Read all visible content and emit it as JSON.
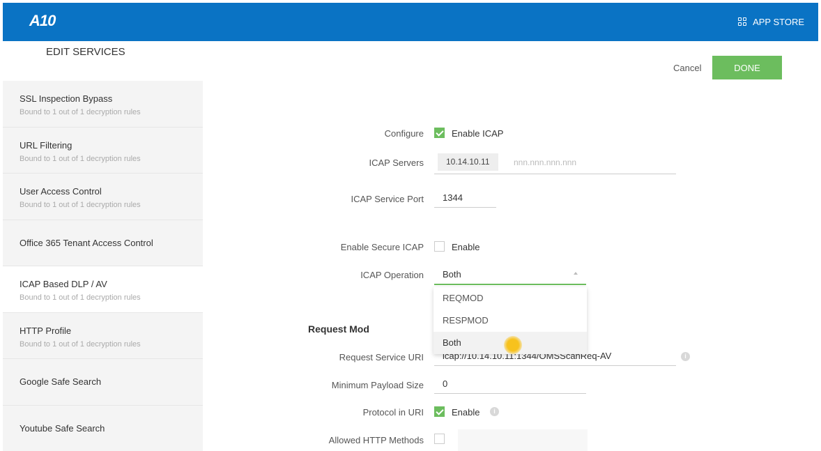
{
  "header": {
    "logo_text": "A10",
    "app_store_label": "APP STORE",
    "bar_color": "#0a73c4"
  },
  "page": {
    "title": "EDIT SERVICES",
    "cancel_label": "Cancel",
    "done_label": "DONE",
    "accent_color": "#6cbd5e"
  },
  "sidebar": {
    "items": [
      {
        "title": "SSL Inspection Bypass",
        "subtitle": "Bound to 1 out of 1 decryption rules"
      },
      {
        "title": "URL Filtering",
        "subtitle": "Bound to 1 out of 1 decryption rules"
      },
      {
        "title": "User Access Control",
        "subtitle": "Bound to 1 out of 1 decryption rules"
      },
      {
        "title": "Office 365 Tenant Access Control",
        "subtitle": ""
      },
      {
        "title": "ICAP Based DLP / AV",
        "subtitle": "Bound to 1 out of 1 decryption rules",
        "active": true
      },
      {
        "title": "HTTP Profile",
        "subtitle": "Bound to 1 out of 1 decryption rules"
      },
      {
        "title": "Google Safe Search",
        "subtitle": ""
      },
      {
        "title": "Youtube Safe Search",
        "subtitle": ""
      }
    ]
  },
  "form": {
    "configure_label": "Configure",
    "enable_icap_label": "Enable ICAP",
    "enable_icap_checked": true,
    "icap_servers_label": "ICAP Servers",
    "icap_server_value": "10.14.10.11",
    "icap_server_placeholder": "nnn.nnn.nnn.nnn",
    "icap_port_label": "ICAP Service Port",
    "icap_port_value": "1344",
    "secure_icap_label": "Enable Secure ICAP",
    "secure_icap_option": "Enable",
    "secure_icap_checked": false,
    "icap_operation_label": "ICAP Operation",
    "icap_operation_value": "Both",
    "icap_operation_options": [
      "REQMOD",
      "RESPMOD",
      "Both"
    ],
    "request_mod_heading": "Request Mod",
    "request_uri_label": "Request Service URI",
    "request_uri_value": "icap://10.14.10.11:1344/OMSScanReq-AV",
    "min_payload_label": "Minimum Payload Size",
    "min_payload_value": "0",
    "protocol_uri_label": "Protocol in URI",
    "protocol_uri_option": "Enable",
    "protocol_uri_checked": true,
    "allowed_methods_label": "Allowed HTTP Methods",
    "info_glyph": "i"
  }
}
